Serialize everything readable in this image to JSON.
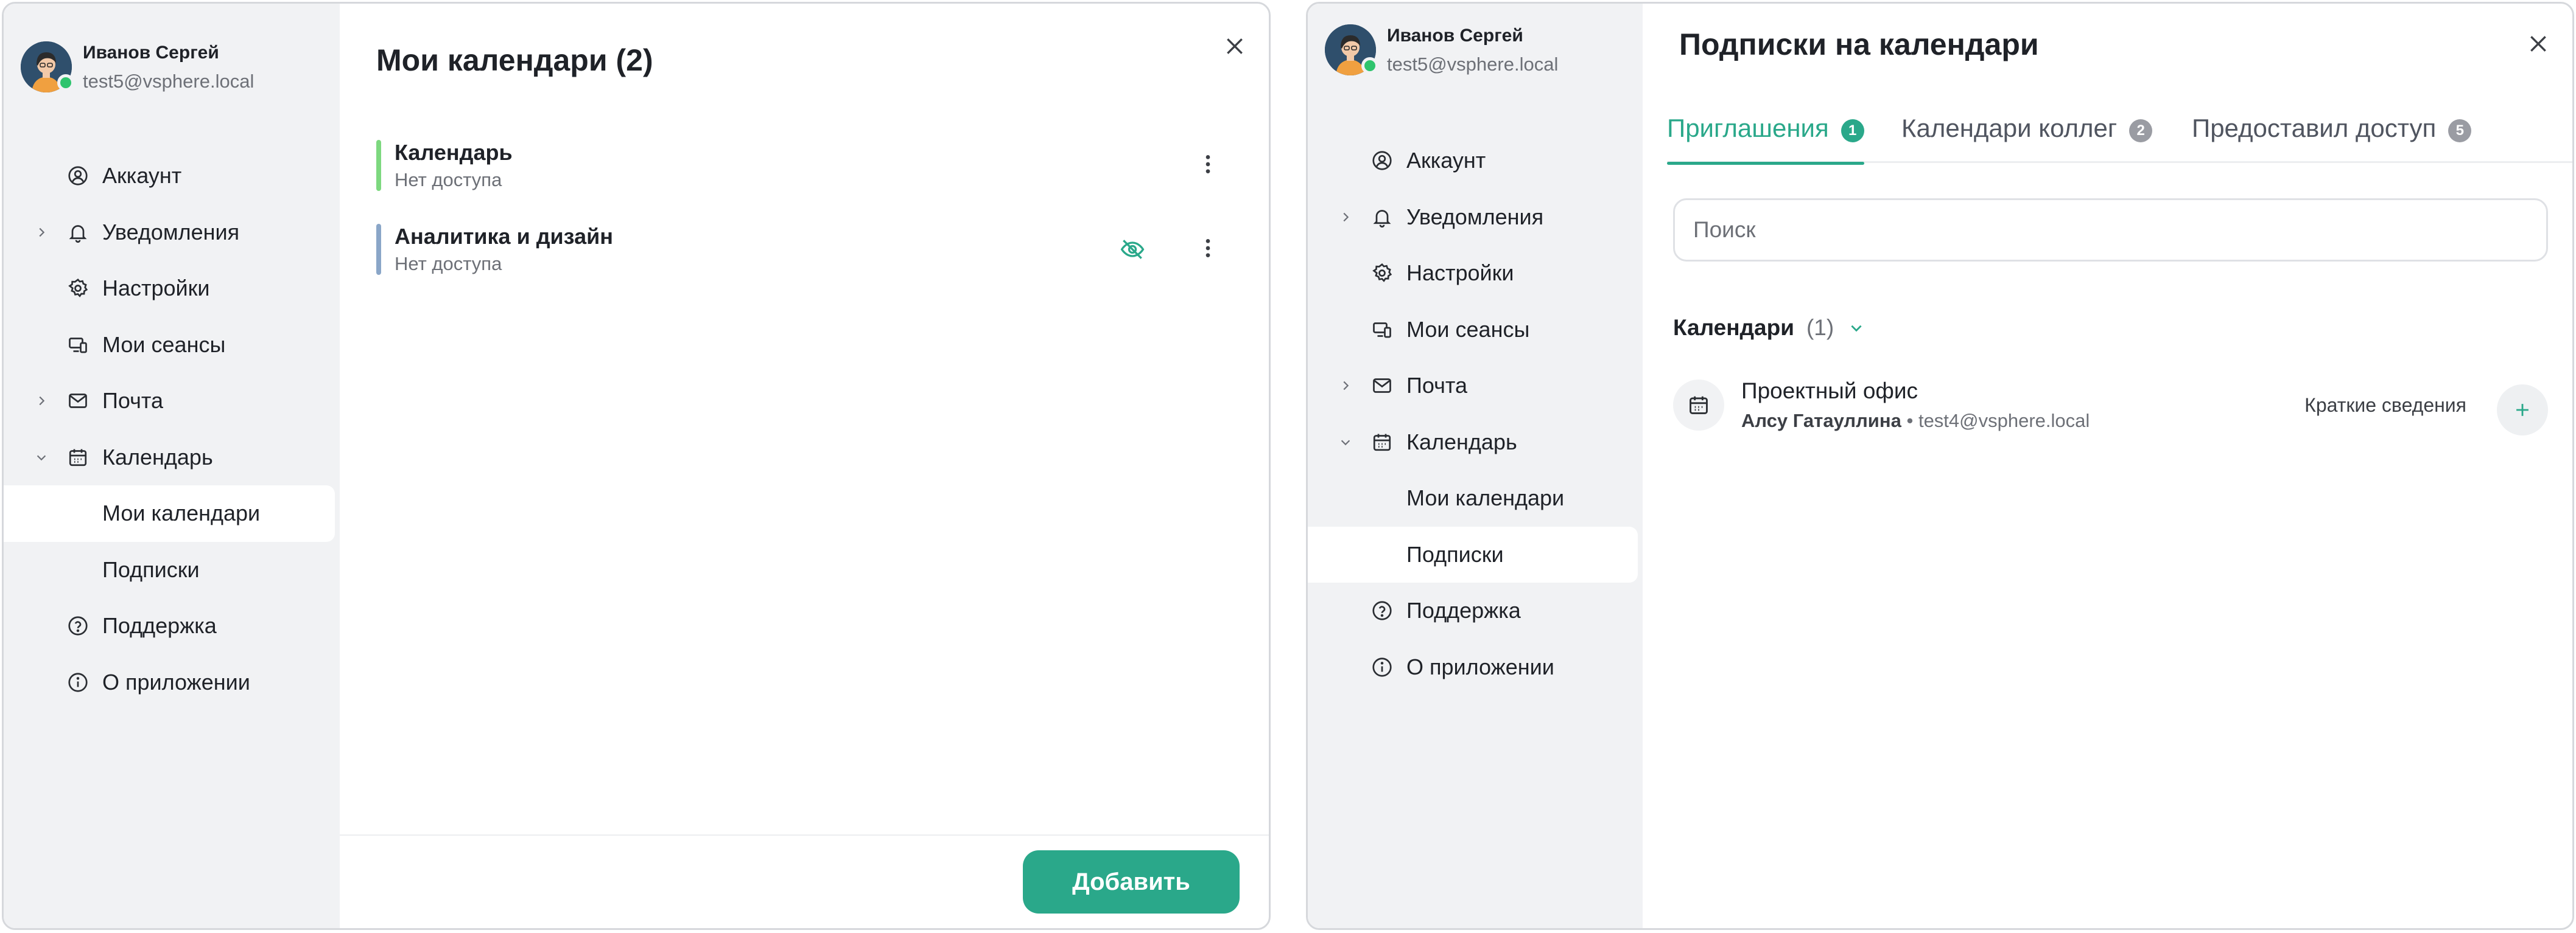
{
  "colors": {
    "accent": "#2aa88a",
    "calendar_bar_green": "#7dd87f",
    "calendar_bar_blue": "#8aa6c8",
    "presence_online": "#2ec46d"
  },
  "left_window": {
    "profile": {
      "name": "Иванов Сергей",
      "email": "test5@vsphere.local"
    },
    "nav": {
      "account": "Аккаунт",
      "notifications": "Уведомления",
      "settings": "Настройки",
      "sessions": "Мои сеансы",
      "mail": "Почта",
      "calendar": "Календарь",
      "my_calendars": "Мои календари",
      "subscriptions": "Подписки",
      "support": "Поддержка",
      "about": "О приложении"
    },
    "title": "Мои календари (2)",
    "calendars": [
      {
        "name": "Календарь",
        "access": "Нет доступа",
        "color_name": "green"
      },
      {
        "name": "Аналитика и дизайн",
        "access": "Нет доступа",
        "color_name": "blue",
        "hidden_icon": "eye-off-icon"
      }
    ],
    "add_button": "Добавить"
  },
  "right_window": {
    "profile": {
      "name": "Иванов Сергей",
      "email": "test5@vsphere.local"
    },
    "nav": {
      "account": "Аккаунт",
      "notifications": "Уведомления",
      "settings": "Настройки",
      "sessions": "Мои сеансы",
      "mail": "Почта",
      "calendar": "Календарь",
      "my_calendars": "Мои календари",
      "subscriptions": "Подписки",
      "support": "Поддержка",
      "about": "О приложении"
    },
    "title": "Подписки на календари",
    "tabs": [
      {
        "label": "Приглашения",
        "count": "1",
        "active": true
      },
      {
        "label": "Календари коллег",
        "count": "2",
        "active": false
      },
      {
        "label": "Предоставил доступ",
        "count": "5",
        "active": false
      }
    ],
    "search_placeholder": "Поиск",
    "section": {
      "title": "Календари",
      "count": "(1)"
    },
    "subscription": {
      "name": "Проектный офис",
      "owner": "Алсу Гатауллина",
      "separator": "•",
      "owner_email": "test4@vsphere.local",
      "brief_label": "Краткие сведения"
    }
  }
}
